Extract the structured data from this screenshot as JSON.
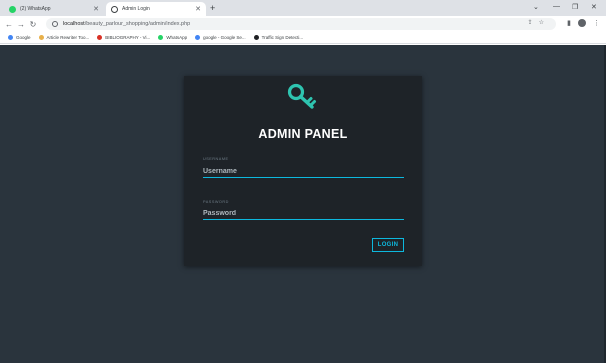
{
  "browser": {
    "tabs": [
      {
        "title": "(2) WhatsApp",
        "icon": "whatsapp-icon"
      },
      {
        "title": "Admin Login",
        "icon": "globe-icon"
      }
    ],
    "new_tab": "+",
    "window_controls": {
      "collapse": "⌄",
      "minimize": "—",
      "maximize": "❐",
      "close": "✕"
    },
    "url_host": "localhost",
    "url_path": "/beauty_parlour_shopping/admin/index.php",
    "bookmarks": [
      {
        "label": "Google",
        "icon": "google-icon",
        "color": "#4285f4"
      },
      {
        "label": "Article Rewriter Too...",
        "icon": "article-icon",
        "color": "#e8b04a"
      },
      {
        "label": "BIBLIOGRAPHY - Vi...",
        "icon": "bibliography-icon",
        "color": "#d93025"
      },
      {
        "label": "WhatsApp",
        "icon": "whatsapp-icon",
        "color": "#25d366"
      },
      {
        "label": "google - Google Se...",
        "icon": "google-icon",
        "color": "#4285f4"
      },
      {
        "label": "Traffic Sign Detecti...",
        "icon": "github-icon",
        "color": "#202124"
      }
    ]
  },
  "login": {
    "title": "ADMIN PANEL",
    "username_label": "USERNAME",
    "username_placeholder": "Username",
    "password_label": "PASSWORD",
    "password_placeholder": "Password",
    "button": "LOGIN"
  },
  "colors": {
    "page_bg": "#2a343d",
    "card_bg": "#1e2328",
    "accent": "#0db8de",
    "key_icon": "#2ec4b0"
  }
}
